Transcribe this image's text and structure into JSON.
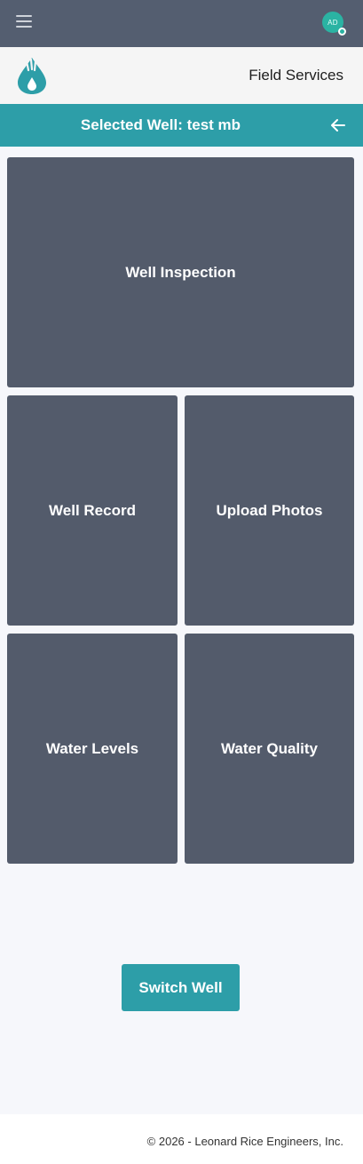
{
  "header": {
    "menu_icon": "hamburger-menu-icon",
    "avatar_initials": "AD",
    "status_color": "#2bb3a3"
  },
  "brand": {
    "logo_icon": "water-drop-hand-logo",
    "app_title": "Field Services",
    "brand_color": "#2d9ea8"
  },
  "well_bar": {
    "label": "Selected Well: test mb",
    "back_icon": "arrow-left-icon"
  },
  "tiles": {
    "well_inspection": "Well Inspection",
    "well_record": "Well Record",
    "upload_photos": "Upload Photos",
    "water_levels": "Water Levels",
    "water_quality": "Water Quality",
    "tile_color": "#535b6b"
  },
  "actions": {
    "switch_well": "Switch Well"
  },
  "footer": {
    "copyright": "© 2026 - Leonard Rice Engineers, Inc."
  }
}
